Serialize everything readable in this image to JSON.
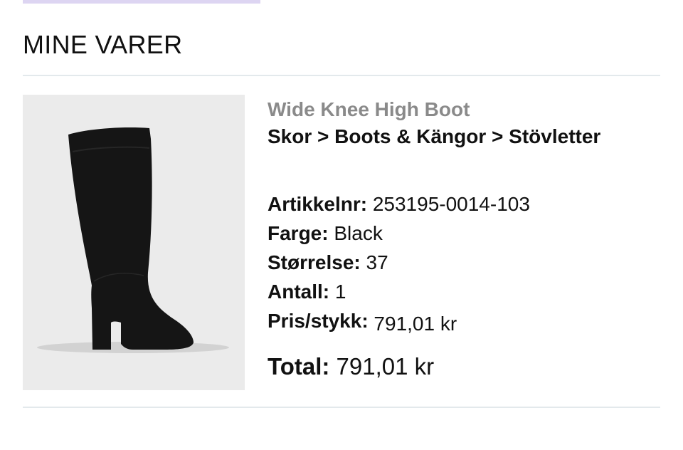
{
  "section": {
    "title": "MINE VARER"
  },
  "product": {
    "image_alt": "Black knee high boot",
    "name": "Wide Knee High Boot",
    "breadcrumb": "Skor > Boots & Kängor > Stövletter",
    "attributes": {
      "article_label": "Artikkelnr:",
      "article_value": "253195-0014-103",
      "color_label": "Farge:",
      "color_value": "Black",
      "size_label": "Størrelse:",
      "size_value": "37",
      "quantity_label": "Antall:",
      "quantity_value": "1",
      "unit_price_label": "Pris/stykk:",
      "unit_price_value": "791,01 kr"
    },
    "total_label": "Total:",
    "total_value": "791,01 kr"
  },
  "colors": {
    "accent_bar": "#ddd5f2",
    "divider": "#e3e9ec",
    "image_bg": "#ebebeb",
    "muted_text": "#8a8a8a"
  }
}
